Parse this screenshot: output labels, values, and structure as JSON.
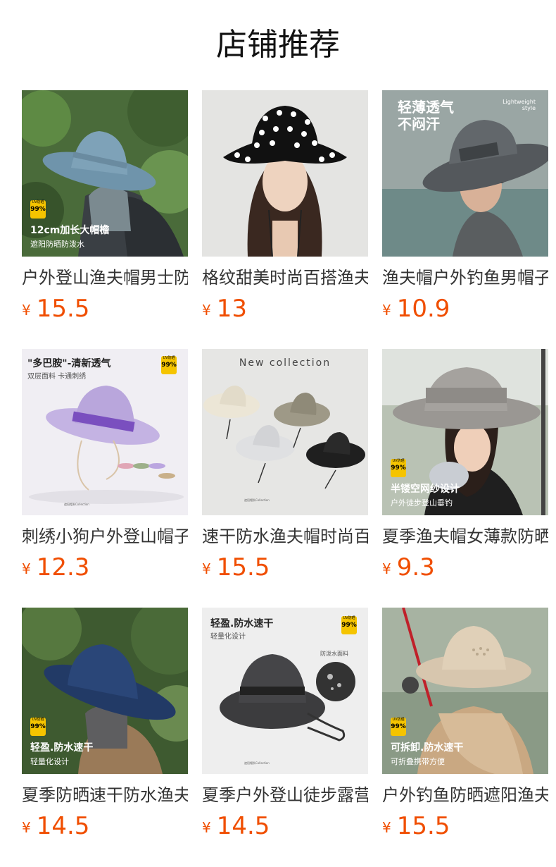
{
  "page": {
    "title": "店铺推荐"
  },
  "products": [
    {
      "name": "户外登山渔夫帽男士防晒遮阳帽",
      "currency": "¥",
      "price": "15.5",
      "overlay": {
        "main": "12cm加长大帽檐",
        "sub": "遮阳防晒防泼水",
        "badge": "99%"
      }
    },
    {
      "name": "格纹甜美时尚百搭渔夫帽",
      "currency": "¥",
      "price": "13"
    },
    {
      "name": "渔夫帽户外钓鱼男帽子",
      "currency": "¥",
      "price": "10.9",
      "overlay": {
        "headline": "轻薄透气\n不闷汗",
        "english": "Lightweight\nstyle"
      }
    },
    {
      "name": "刺绣小狗户外登山帽子",
      "currency": "¥",
      "price": "12.3",
      "overlay": {
        "main": "\"多巴胺\"-清新透气",
        "sub": "双层面料 卡通刺绣",
        "badge": "99%",
        "fine": "遮阳帽系Collection"
      }
    },
    {
      "name": "速干防水渔夫帽时尚百搭",
      "currency": "¥",
      "price": "15.5",
      "overlay": {
        "collection": "New collection",
        "fine": "遮阳帽系Collection"
      }
    },
    {
      "name": "夏季渔夫帽女薄款防晒帽",
      "currency": "¥",
      "price": "9.3",
      "overlay": {
        "main": "半镂空网纱设计",
        "sub": "户外徒步登山垂钓",
        "badge": "99%"
      }
    },
    {
      "name": "夏季防晒速干防水渔夫帽",
      "currency": "¥",
      "price": "14.5",
      "overlay": {
        "main": "轻盈.防水速干",
        "sub": "轻量化设计",
        "badge": "99%"
      }
    },
    {
      "name": "夏季户外登山徒步露营帽",
      "currency": "¥",
      "price": "14.5",
      "overlay": {
        "main": "轻盈.防水速干",
        "sub": "轻量化设计",
        "badge": "99%",
        "fabric": "防泼水面料",
        "fine": "遮阳帽系Collection"
      }
    },
    {
      "name": "户外钓鱼防晒遮阳渔夫帽",
      "currency": "¥",
      "price": "15.5",
      "overlay": {
        "main": "可拆卸.防水速干",
        "sub": "可折叠携带方便",
        "badge": "99%"
      }
    }
  ],
  "colors": {
    "price": "#f04e00",
    "text": "#333333",
    "badge": "#f5c400"
  }
}
